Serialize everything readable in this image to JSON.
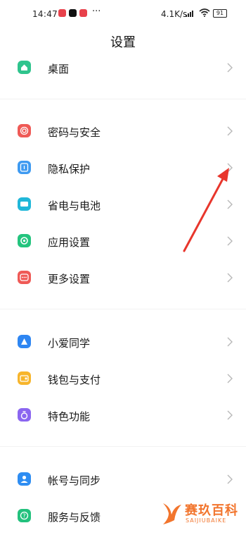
{
  "status_bar": {
    "time": "14:47",
    "more": "···",
    "net_speed": "4.1K/s",
    "battery": "91"
  },
  "page": {
    "title": "设置"
  },
  "groups": [
    {
      "items": [
        {
          "label": "桌面",
          "icon": "home-icon",
          "color": "#2fc48d"
        }
      ]
    },
    {
      "items": [
        {
          "label": "密码与安全",
          "icon": "fingerprint-icon",
          "color": "#ef5a56"
        },
        {
          "label": "隐私保护",
          "icon": "privacy-icon",
          "color": "#3e9af1"
        },
        {
          "label": "省电与电池",
          "icon": "battery-icon",
          "color": "#20b7d9"
        },
        {
          "label": "应用设置",
          "icon": "app-settings-icon",
          "color": "#24c47e"
        },
        {
          "label": "更多设置",
          "icon": "more-icon",
          "color": "#ef5a56"
        }
      ]
    },
    {
      "items": [
        {
          "label": "小爱同学",
          "icon": "assistant-icon",
          "color": "#2e86f2"
        },
        {
          "label": "钱包与支付",
          "icon": "wallet-icon",
          "color": "#f7b52c"
        },
        {
          "label": "特色功能",
          "icon": "features-icon",
          "color": "#8b66f0"
        }
      ]
    },
    {
      "items": [
        {
          "label": "帐号与同步",
          "icon": "account-icon",
          "color": "#2e8df2"
        },
        {
          "label": "服务与反馈",
          "icon": "feedback-icon",
          "color": "#23c17d"
        }
      ]
    }
  ],
  "watermark": {
    "name": "赛玖百科",
    "sub": "SAIJIUBAIKE"
  },
  "colors": {
    "annotation_arrow": "#e8362c",
    "chevron": "#b8b8b8"
  }
}
